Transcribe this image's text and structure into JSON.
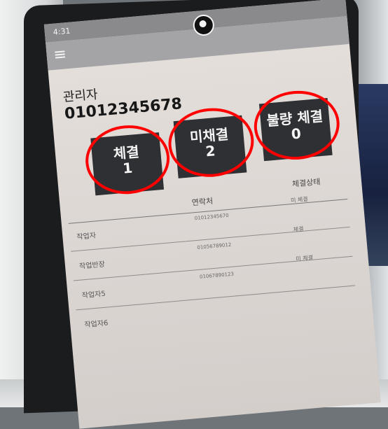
{
  "status_bar": {
    "time": "4:31"
  },
  "header": {
    "title": "관리자",
    "phone": "01012345678"
  },
  "stats": [
    {
      "label": "체결",
      "value": "1"
    },
    {
      "label": "미채결",
      "value": "2"
    },
    {
      "label": "불량 체결",
      "value": "0"
    }
  ],
  "table": {
    "columns": [
      "연락처",
      "체결상태"
    ],
    "rows": [
      {
        "name": "작업자",
        "phone": "01012345670",
        "status": "미 체결"
      },
      {
        "name": "작업반장",
        "phone": "01056789012",
        "status": "체결"
      },
      {
        "name": "작업자5",
        "phone": "01067890123",
        "status": "미 체결"
      },
      {
        "name": "작업자6",
        "phone": "",
        "status": ""
      }
    ]
  },
  "colors": {
    "accent": "#ff0000",
    "card": "#2f3033",
    "screen": "#e6e0dc"
  },
  "icons": {
    "menu": "menu-icon",
    "logo": "logo-icon"
  }
}
